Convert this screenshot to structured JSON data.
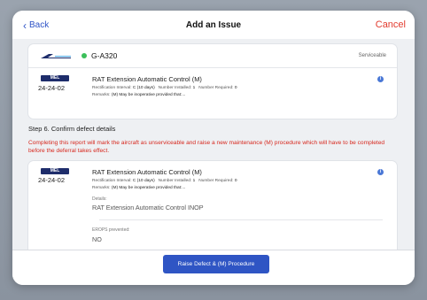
{
  "nav": {
    "back_label": "Back",
    "title": "Add an Issue",
    "cancel_label": "Cancel"
  },
  "aircraft": {
    "registration": "G-A320",
    "status": "Serviceable",
    "status_color": "#3bbf5a"
  },
  "defect": {
    "type": "MEL",
    "ref": "24-24-02",
    "title": "RAT Extension Automatic Control (M)",
    "rectification_label": "Rectification Interval:",
    "rectification_value": "C (10 days)",
    "installed_label": "Number Installed:",
    "installed_value": "1",
    "required_label": "Number Required:",
    "required_value": "0",
    "remarks_label": "Remarks:",
    "remarks_value": "(M) May be inoperative provided that:..."
  },
  "step": {
    "title": "Step 6. Confirm defect details"
  },
  "warning": {
    "text": "Completing this report will mark the aircraft as unserviceable and raise a new maintenance (M) procedure which will have to be completed before the deferral takes effect."
  },
  "details": {
    "details_label": "Details:",
    "details_value": "RAT Extension Automatic Control INOP",
    "etops_label": "EROPS prevented:",
    "etops_value": "NO"
  },
  "footer": {
    "action_label": "Raise Defect & (M) Procedure"
  },
  "icons": {
    "back": "chevron-left-icon",
    "info": "info-icon",
    "status": "status-dot-icon"
  }
}
